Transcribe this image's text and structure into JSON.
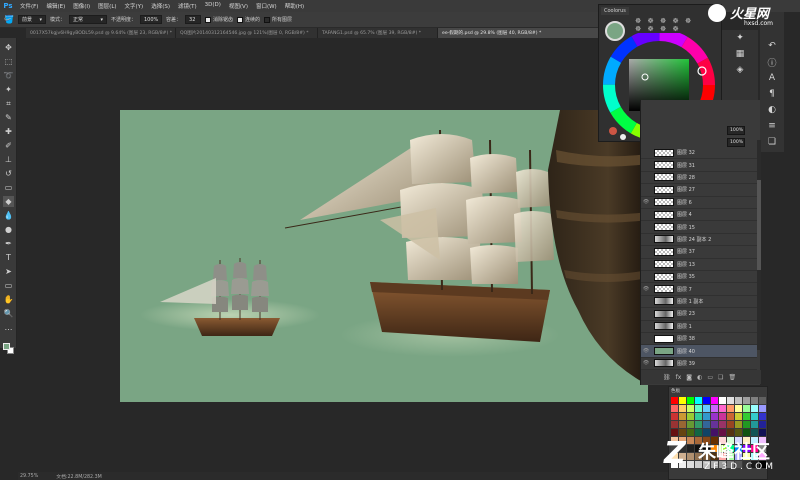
{
  "menubar": {
    "logo": "Ps",
    "items": [
      "文件(F)",
      "编辑(E)",
      "图像(I)",
      "图层(L)",
      "文字(Y)",
      "选择(S)",
      "滤镜(T)",
      "3D(D)",
      "视图(V)",
      "窗口(W)",
      "帮助(H)"
    ]
  },
  "options": {
    "brush_size": "前景",
    "mode_label": "模式：",
    "mode_value": "正常",
    "opacity_label": "不透明度：",
    "opacity_value": "100%",
    "tolerance_label": "容差：",
    "tolerance_value": "32",
    "antialias_label": "消除锯齿",
    "contiguous_label": "连续的",
    "all_layers_label": "所有图层"
  },
  "tabs": [
    {
      "label": "0017X57kgjv6H9gyBODL59.psd @ 9.64% (图层 23, RGB/8#) *",
      "active": false
    },
    {
      "label": "QQ图片20140312164546.jpg @ 121%(图层 0, RGB/8#) *",
      "active": false
    },
    {
      "label": "TAFANG1.psd @ 65.7% (图层 39, RGB/8#) *",
      "active": false
    },
    {
      "label": "ee-假期的.psd @ 29.8% (图层 40, RGB/8#) *",
      "active": true
    }
  ],
  "coolorus": {
    "title": "Coolorus",
    "current_color": "#7aa584"
  },
  "layers": {
    "opacity_value": "100%",
    "fill_value": "100%",
    "rows": [
      {
        "name": "图层 32",
        "thumb": "checker",
        "visible": false,
        "selected": false
      },
      {
        "name": "图层 31",
        "thumb": "checker",
        "visible": false,
        "selected": false
      },
      {
        "name": "图层 28",
        "thumb": "checker",
        "visible": false,
        "selected": false
      },
      {
        "name": "图层 27",
        "thumb": "checker",
        "visible": false,
        "selected": false
      },
      {
        "name": "图层 6",
        "thumb": "checker",
        "visible": true,
        "selected": false
      },
      {
        "name": "图层 4",
        "thumb": "checker",
        "visible": false,
        "selected": false
      },
      {
        "name": "图层 15",
        "thumb": "checker",
        "visible": false,
        "selected": false
      },
      {
        "name": "图层 24 副本 2",
        "thumb": "img",
        "visible": false,
        "selected": false
      },
      {
        "name": "图层 37",
        "thumb": "checker",
        "visible": false,
        "selected": false
      },
      {
        "name": "图层 13",
        "thumb": "checker",
        "visible": false,
        "selected": false
      },
      {
        "name": "图层 35",
        "thumb": "checker",
        "visible": false,
        "selected": false
      },
      {
        "name": "图层 7",
        "thumb": "checker",
        "visible": true,
        "selected": false
      },
      {
        "name": "图层 1 副本",
        "thumb": "img",
        "visible": false,
        "selected": false
      },
      {
        "name": "图层 23",
        "thumb": "img",
        "visible": false,
        "selected": false
      },
      {
        "name": "图层 1",
        "thumb": "img",
        "visible": false,
        "selected": false
      },
      {
        "name": "图层 38",
        "thumb": "white",
        "visible": false,
        "selected": false
      },
      {
        "name": "图层 40",
        "thumb": "green",
        "visible": true,
        "selected": true
      },
      {
        "name": "图层 39",
        "thumb": "img",
        "visible": true,
        "selected": false
      }
    ]
  },
  "swatches": {
    "tab_label": "色板"
  },
  "status": {
    "zoom": "29.75%",
    "doc_size": "文档:22.8M/282.3M"
  },
  "watermark_top": {
    "text": "火星网",
    "url": "hxsd.com"
  },
  "watermark_bottom": {
    "text": "朱峰社区",
    "url": "ZF3D.COM"
  }
}
